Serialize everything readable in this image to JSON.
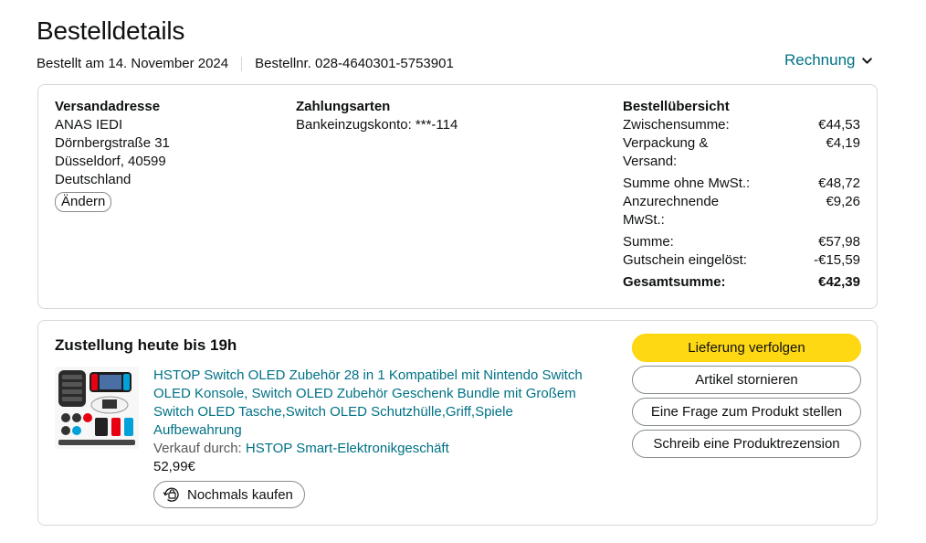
{
  "header": {
    "title": "Bestelldetails",
    "ordered_on": "Bestellt am 14. November 2024",
    "order_number": "Bestellnr. 028-4640301-5753901",
    "invoice_label": "Rechnung",
    "invoice_icon": "chevron-down-icon"
  },
  "address": {
    "heading": "Versandadresse",
    "lines": [
      "ANAS IEDI",
      "Dörnbergstraße 31",
      "Düsseldorf, 40599",
      "Deutschland"
    ],
    "change_label": "Ändern"
  },
  "payment": {
    "heading": "Zahlungsarten",
    "method": "Bankeinzugskonto: ***-114"
  },
  "overview": {
    "heading": "Bestellübersicht",
    "rows": [
      {
        "label": "Zwischensumme:",
        "value": "€44,53"
      },
      {
        "label": "Verpackung & Versand:",
        "value": "€4,19"
      },
      {
        "label": "Summe ohne MwSt.:",
        "value": "€48,72"
      },
      {
        "label": "Anzurechnende MwSt.:",
        "value": "€9,26"
      },
      {
        "label": "Summe:",
        "value": "€57,98"
      },
      {
        "label": "Gutschein eingelöst:",
        "value": "-€15,59"
      },
      {
        "label": "Gesamtsumme:",
        "value": "€42,39"
      }
    ]
  },
  "delivery": {
    "title": "Zustellung heute bis 19h",
    "product": {
      "title": "HSTOP Switch OLED Zubehör 28 in 1 Kompatibel mit Nintendo Switch OLED Konsole, Switch OLED Zubehör Geschenk Bundle mit Großem Switch OLED Tasche,Switch OLED Schutzhülle,Griff,Spiele Aufbewahrung",
      "sold_by_label": "Verkauf durch:",
      "seller": "HSTOP Smart-Elektronikgeschäft",
      "price": "52,99€",
      "buy_again_label": "Nochmals kaufen",
      "buy_again_icon": "reorder-bag-icon"
    },
    "actions": {
      "track": "Lieferung verfolgen",
      "cancel": "Artikel stornieren",
      "question": "Eine Frage zum Produkt stellen",
      "review": "Schreib eine Produktrezension"
    }
  },
  "colors": {
    "link": "#007185",
    "primary_button": "#FFD814",
    "border": "#D5D9D9",
    "text": "#0F1111",
    "muted": "#565959"
  }
}
